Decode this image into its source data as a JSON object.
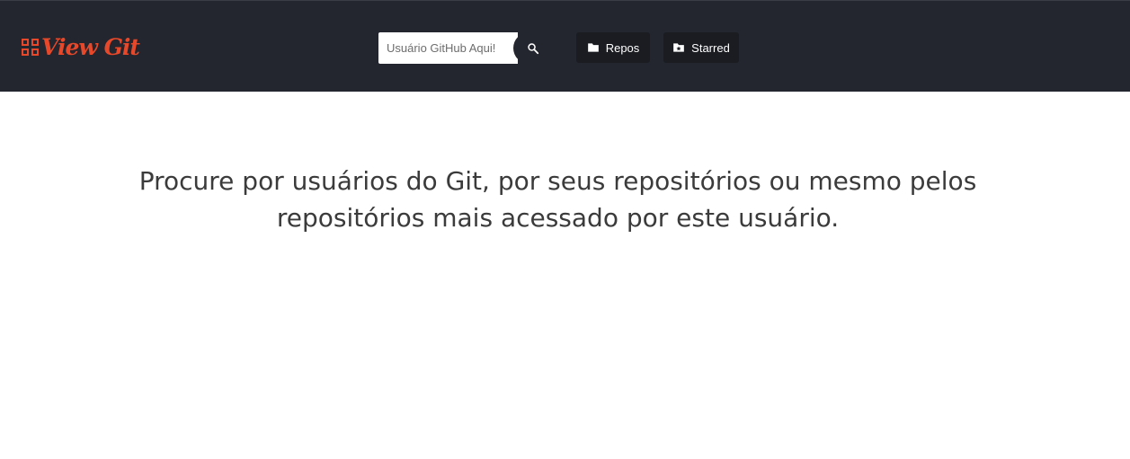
{
  "header": {
    "logo_text": "View Git",
    "logo_icon": "grid-icon",
    "accent_color": "#e8482a",
    "background_color": "#23262e"
  },
  "search": {
    "placeholder": "Usuário GitHub Aqui!",
    "value": "",
    "button_icon": "search-icon"
  },
  "nav": {
    "repos_label": "Repos",
    "repos_icon": "folder-icon",
    "starred_label": "Starred",
    "starred_icon": "folder-star-icon"
  },
  "main": {
    "message_line1": "Procure por usuários do Git, por seus repositórios ou mesmo pelos",
    "message_line2": "repositórios mais acessado por este usuário."
  }
}
